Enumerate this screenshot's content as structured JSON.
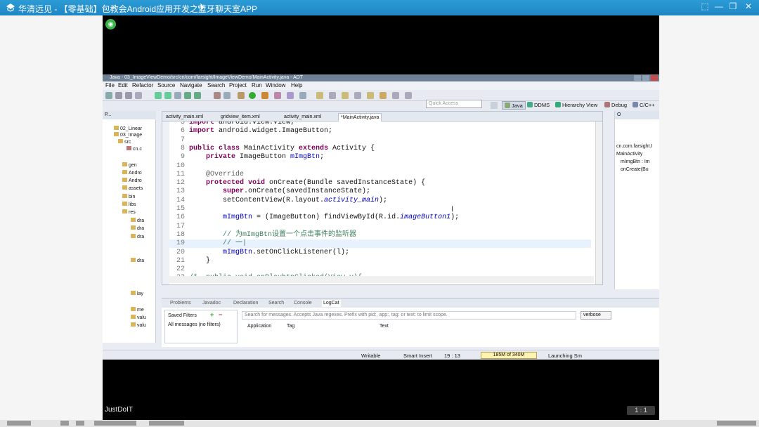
{
  "window": {
    "title": "华清远见 - 【零基础】包教会Android应用开发之蓝牙聊天室APP",
    "controls": [
      "⬚",
      "—",
      "❐",
      "✕"
    ]
  },
  "player": {
    "watermark": "JustDoIT",
    "page_indicator": "1 : 1"
  },
  "eclipse": {
    "title": "Java - 03_ImageViewDemo/src/cn/com/farsight/ImageViewDemo/MainActivity.java - ADT",
    "menu": [
      "File",
      "Edit",
      "Refactor",
      "Source",
      "Navigate",
      "Search",
      "Project",
      "Run",
      "Window",
      "Help"
    ],
    "quick_access": "Quick Access",
    "perspectives": [
      "Java",
      "DDMS",
      "Hierarchy View",
      "Debug",
      "C/C++"
    ],
    "package_explorer": {
      "tab": "P...",
      "nodes": [
        "02_Linear",
        "03_Image",
        "src",
        "cn.c",
        "gen",
        "Andro",
        "Andro",
        "assets",
        "bin",
        "libs",
        "res",
        "dra",
        "dra",
        "dra",
        "dra",
        "lay",
        "me",
        "valu",
        "valu"
      ]
    },
    "editor_tabs": [
      "activity_main.xml",
      "gridview_item.xml",
      "activity_main.xml",
      "*MainActivity.java"
    ],
    "code": [
      {
        "n": "5",
        "segs": [
          {
            "t": "import ",
            "c": "kw"
          },
          {
            "t": "android.view.View;",
            "c": ""
          }
        ]
      },
      {
        "n": "6",
        "segs": [
          {
            "t": "import ",
            "c": "kw"
          },
          {
            "t": "android.widget.ImageButton;",
            "c": ""
          }
        ]
      },
      {
        "n": "7",
        "segs": []
      },
      {
        "n": "8",
        "segs": [
          {
            "t": "public class ",
            "c": "kw"
          },
          {
            "t": "MainActivity ",
            "c": ""
          },
          {
            "t": "extends ",
            "c": "kw"
          },
          {
            "t": "Activity {",
            "c": ""
          }
        ]
      },
      {
        "n": "9",
        "segs": [
          {
            "t": "    ",
            "c": ""
          },
          {
            "t": "private ",
            "c": "kw"
          },
          {
            "t": "ImageButton ",
            "c": ""
          },
          {
            "t": "mImgBtn",
            "c": "fd2"
          },
          {
            "t": ";",
            "c": ""
          }
        ]
      },
      {
        "n": "10",
        "segs": []
      },
      {
        "n": "11",
        "segs": [
          {
            "t": "    ",
            "c": ""
          },
          {
            "t": "@Override",
            "c": "an"
          }
        ]
      },
      {
        "n": "12",
        "segs": [
          {
            "t": "    ",
            "c": ""
          },
          {
            "t": "protected void ",
            "c": "kw"
          },
          {
            "t": "onCreate(Bundle savedInstanceState) {",
            "c": ""
          }
        ]
      },
      {
        "n": "13",
        "segs": [
          {
            "t": "        ",
            "c": ""
          },
          {
            "t": "super",
            "c": "kw"
          },
          {
            "t": ".onCreate(savedInstanceState);",
            "c": ""
          }
        ]
      },
      {
        "n": "14",
        "segs": [
          {
            "t": "        setContentView(R.layout.",
            "c": ""
          },
          {
            "t": "activity_main",
            "c": "fd"
          },
          {
            "t": ");",
            "c": ""
          }
        ]
      },
      {
        "n": "15",
        "segs": []
      },
      {
        "n": "16",
        "segs": [
          {
            "t": "        ",
            "c": ""
          },
          {
            "t": "mImgBtn",
            "c": "fd2"
          },
          {
            "t": " = (ImageButton) findViewById(R.id.",
            "c": ""
          },
          {
            "t": "imageButton1",
            "c": "fd"
          },
          {
            "t": ");",
            "c": ""
          }
        ]
      },
      {
        "n": "17",
        "segs": []
      },
      {
        "n": "18",
        "segs": [
          {
            "t": "        ",
            "c": ""
          },
          {
            "t": "// 为mImgBtn设置一个点击事件的监听器",
            "c": "cm"
          }
        ]
      },
      {
        "n": "19",
        "segs": [
          {
            "t": "        ",
            "c": ""
          },
          {
            "t": "// 一|",
            "c": "cm"
          }
        ]
      },
      {
        "n": "20",
        "segs": [
          {
            "t": "        ",
            "c": ""
          },
          {
            "t": "mImgBtn",
            "c": "fd2"
          },
          {
            "t": ".setOnClickListener(l);",
            "c": ""
          }
        ]
      },
      {
        "n": "21",
        "segs": [
          {
            "t": "    }",
            "c": ""
          }
        ]
      },
      {
        "n": "22",
        "segs": []
      },
      {
        "n": "23",
        "segs": [
          {
            "t": "/*  ",
            "c": "cm"
          },
          {
            "t": "public void onPlaybtnClicked(View v){",
            "c": "cm"
          }
        ]
      }
    ],
    "outline": {
      "items": [
        "cn.com.farsight.I",
        "MainActivity",
        "mImgBtn : Im",
        "onCreate(Bu"
      ]
    },
    "bottom_tabs": [
      "Problems",
      "Javadoc",
      "Declaration",
      "Search",
      "Console",
      "LogCat"
    ],
    "logcat": {
      "saved_filters": "Saved Filters",
      "all_messages": "All messages (no filters)",
      "search_placeholder": "Search for messages. Accepts Java regexes. Prefix with pid:, app:, tag: or text: to limit scope.",
      "level": "verbose",
      "columns": [
        "Application",
        "Tag",
        "Text"
      ]
    },
    "status": {
      "writable": "Writable",
      "insert_mode": "Smart Insert",
      "position": "19 : 13",
      "memory": "185M of 340M",
      "job": "Launching Sm"
    }
  }
}
